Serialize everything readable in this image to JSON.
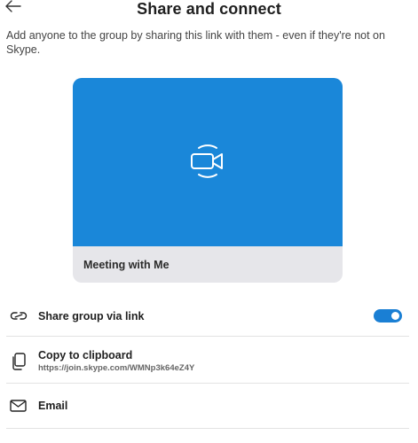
{
  "header": {
    "title": "Share and connect",
    "back_icon": "back-arrow-icon"
  },
  "description": "Add anyone to the group by sharing this link with them - even if they're not on Skype.",
  "meeting_card": {
    "name": "Meeting with Me",
    "icon": "video-camera-icon",
    "preview_color": "#1a87d9"
  },
  "options": {
    "share_link": {
      "label": "Share group via link",
      "icon": "link-icon",
      "toggle_on": true
    },
    "copy": {
      "label": "Copy to clipboard",
      "link": "https://join.skype.com/WMNp3k64eZ4Y",
      "icon": "copy-icon"
    },
    "email": {
      "label": "Email",
      "icon": "email-icon"
    }
  },
  "colors": {
    "accent": "#1a7fd4"
  }
}
